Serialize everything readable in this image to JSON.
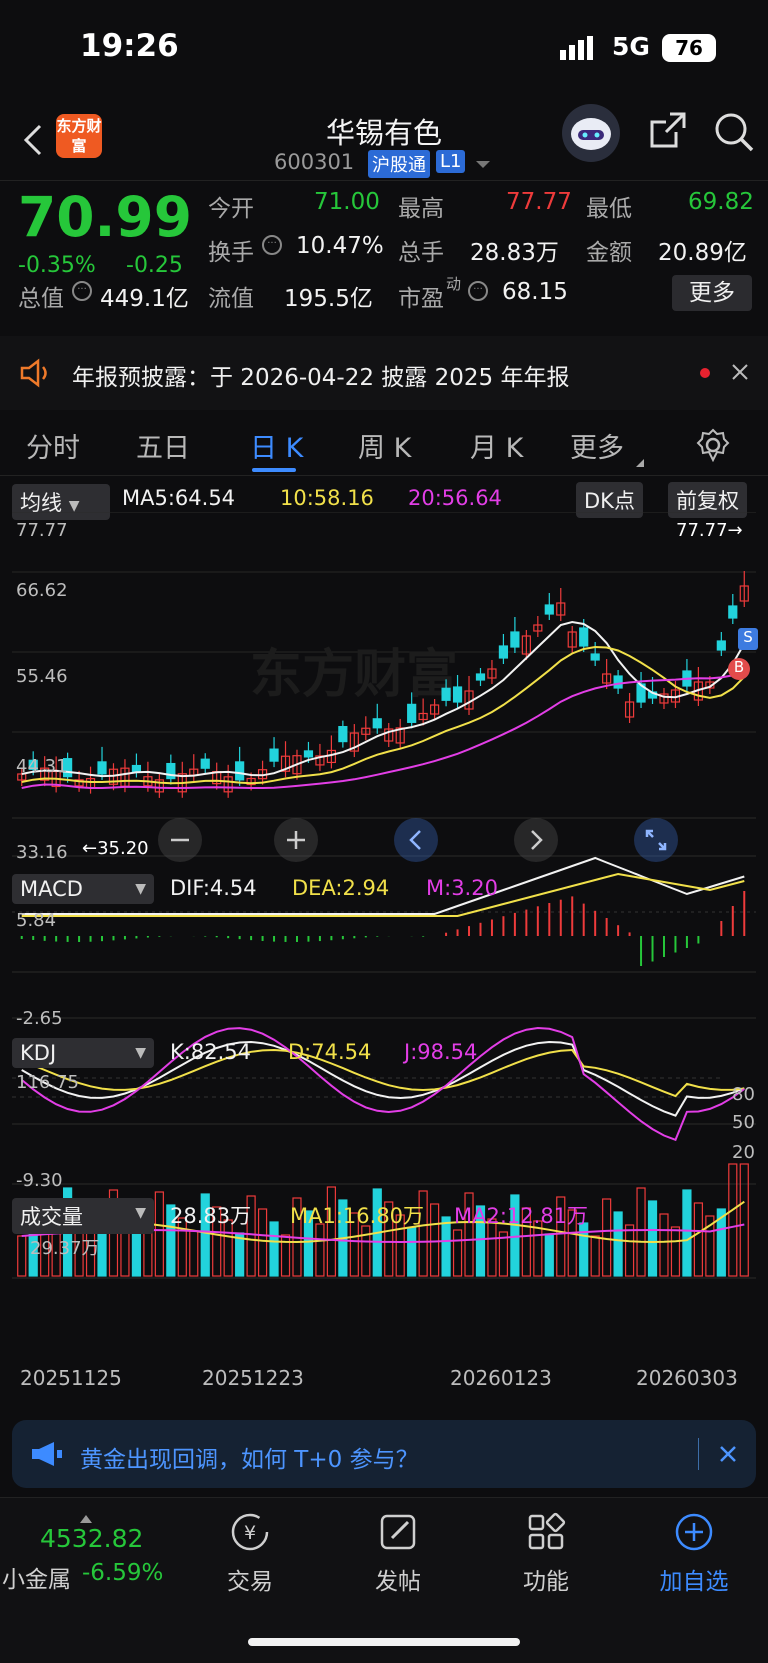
{
  "status": {
    "time": "19:26",
    "network": "5G",
    "battery": "76"
  },
  "header": {
    "title": "华锡有色",
    "code": "600301",
    "badge": "沪股通",
    "level": "L1",
    "logo": "东方财富"
  },
  "quote": {
    "price": "70.99",
    "change_pct": "-0.35%",
    "change": "-0.25",
    "open_label": "今开",
    "open": "71.00",
    "high_label": "最高",
    "high": "77.77",
    "low_label": "最低",
    "low": "69.82",
    "turnover_label": "换手",
    "turnover": "10.47%",
    "volume_label": "总手",
    "volume": "28.83万",
    "amount_label": "金额",
    "amount": "20.89亿",
    "mktcap_label": "总值",
    "mktcap": "449.1亿",
    "float_label": "流值",
    "float": "195.5亿",
    "pe_label": "市盈",
    "pe_sup": "动",
    "pe": "68.15",
    "more": "更多"
  },
  "notice": {
    "text": "年报预披露：于 2026-04-22 披露 2025 年年报"
  },
  "tabs": [
    "分时",
    "五日",
    "日 K",
    "周 K",
    "月 K",
    "更多"
  ],
  "active_tab": "日 K",
  "kline": {
    "indicator": "均线",
    "ma5": "MA5:64.54",
    "ma10": "10:58.16",
    "ma20": "20:56.64",
    "dk": "DK点",
    "adjust": "前复权",
    "y_labels": [
      "77.77",
      "66.62",
      "55.46",
      "44.31",
      "33.16"
    ],
    "high_marker": "77.77→",
    "low_marker": "←35.20",
    "watermark": "东方财富",
    "markers": [
      "S",
      "B"
    ]
  },
  "macd": {
    "name": "MACD",
    "dif": "DIF:4.54",
    "dea": "DEA:2.94",
    "m": "M:3.20",
    "y_labels": [
      "5.84",
      "-2.65"
    ]
  },
  "kdj": {
    "name": "KDJ",
    "k": "K:82.54",
    "d": "D:74.54",
    "j": "J:98.54",
    "y_labels": [
      "116.75",
      "-9.30"
    ],
    "ref": [
      "80",
      "50",
      "20"
    ]
  },
  "vol": {
    "name": "成交量",
    "v": "28.83万",
    "ma1": "MA1:16.80万",
    "ma2": "MA2:12.81万",
    "y_label": "29.37万"
  },
  "dates": [
    "20251125",
    "20251223",
    "20260123",
    "20260303"
  ],
  "ad": {
    "text": "黄金出现回调，如何 T+0 参与？"
  },
  "bottom": {
    "index_value": "4532.82",
    "index_name": "小金属",
    "index_change": "-6.59%",
    "nav": [
      "交易",
      "发帖",
      "功能",
      "加自选"
    ]
  },
  "colors": {
    "up": "#ee3b3b",
    "down": "#26c73a",
    "cyan": "#22d3dc",
    "accent": "#3d8bff"
  }
}
